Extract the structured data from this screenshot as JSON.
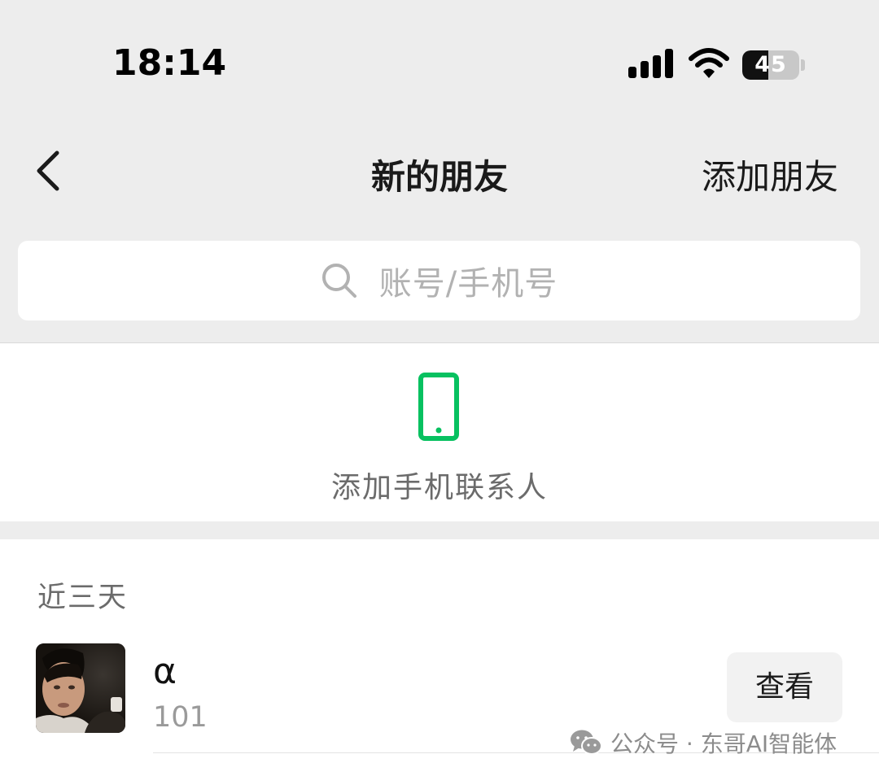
{
  "status_bar": {
    "time": "18:14",
    "battery_level": "45",
    "battery_fraction": 0.45,
    "signal_icon": "cellular-signal-icon",
    "wifi_icon": "wifi-icon"
  },
  "nav": {
    "back_icon": "chevron-left-icon",
    "title": "新的朋友",
    "action_label": "添加朋友"
  },
  "search": {
    "icon": "search-icon",
    "placeholder": "账号/手机号"
  },
  "add_contacts": {
    "icon": "smartphone-icon",
    "label": "添加手机联系人"
  },
  "recent": {
    "header": "近三天",
    "items": [
      {
        "name": "α",
        "subtitle": "101",
        "action_label": "查看"
      }
    ]
  },
  "watermark": {
    "icon": "wechat-icon",
    "text": "公众号 · 东哥AI智能体"
  },
  "colors": {
    "background_gray": "#ededed",
    "accent_green": "#07c160",
    "text_dark": "#1a1a1a",
    "text_secondary": "#6b6b6b",
    "placeholder": "#b2b2b2"
  }
}
